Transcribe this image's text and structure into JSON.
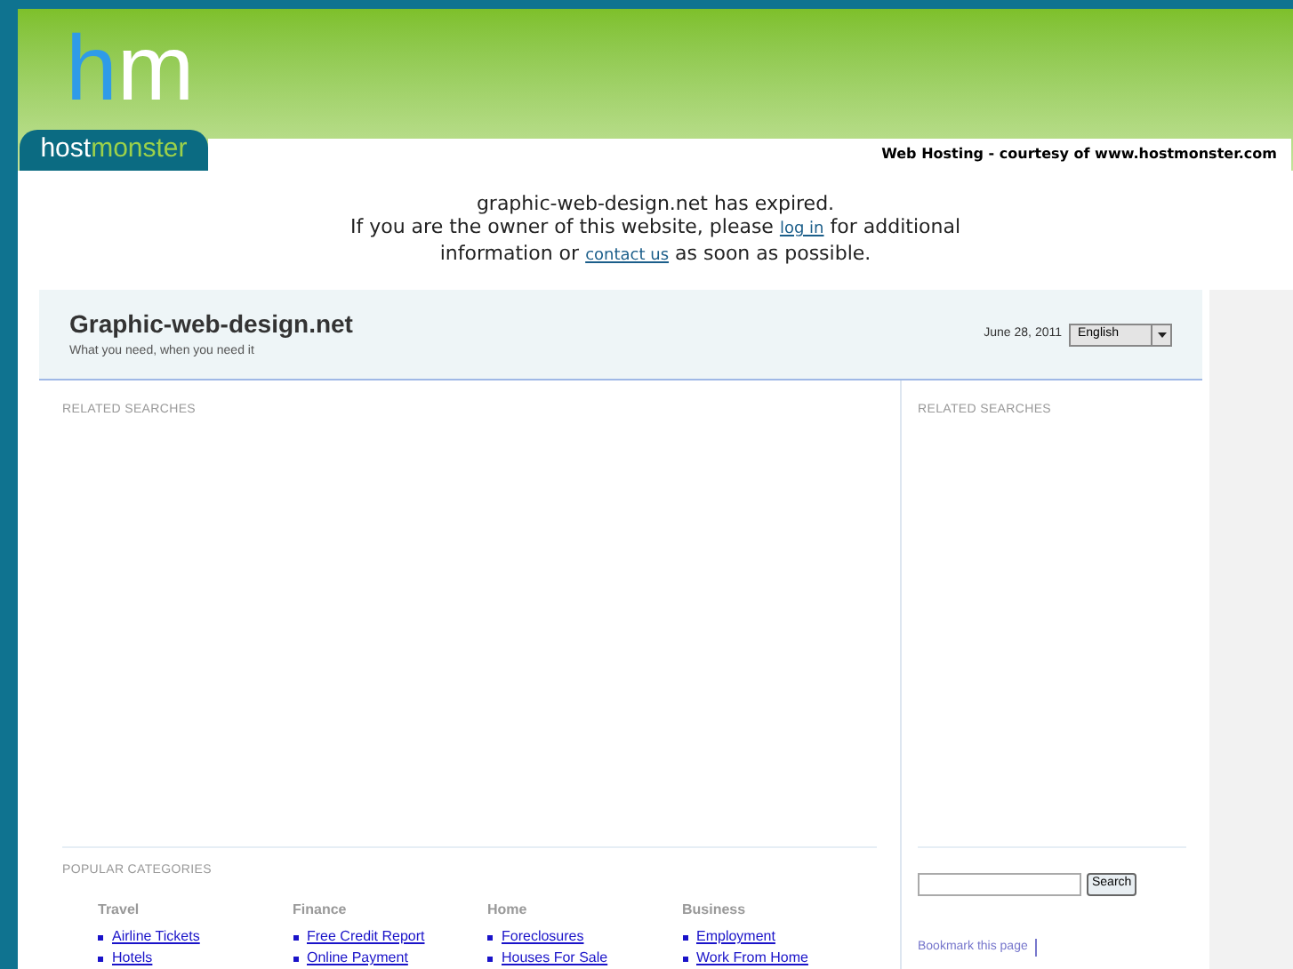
{
  "host_banner": {
    "logo_mark": "hm",
    "logo_word_1": "host",
    "logo_word_2": "monster",
    "courtesy": "Web Hosting - courtesy of www.hostmonster.com"
  },
  "notice": {
    "line_1": "graphic-web-design.net has expired.",
    "line_2_before": "If you are the owner of this website, please",
    "login_link": "log in",
    "line_2_after": "for additional",
    "line_3_before": "information or",
    "contact_link": "contact us",
    "line_3_after": "as soon as possible."
  },
  "site_header": {
    "title": "Graphic-web-design.net",
    "tagline": "What you need, when you need it",
    "date": "June 28, 2011",
    "language": "English"
  },
  "main": {
    "related_heading": "RELATED SEARCHES",
    "popular_heading": "POPULAR CATEGORIES",
    "categories": [
      {
        "name": "Travel",
        "links": [
          "Airline Tickets",
          "Hotels"
        ]
      },
      {
        "name": "Finance",
        "links": [
          "Free Credit Report",
          "Online Payment"
        ]
      },
      {
        "name": "Home",
        "links": [
          "Foreclosures",
          "Houses For Sale"
        ]
      },
      {
        "name": "Business",
        "links": [
          "Employment",
          "Work From Home"
        ]
      }
    ]
  },
  "sidebar": {
    "related_heading": "RELATED SEARCHES",
    "search_button": "Search",
    "bookmark_link": "Bookmark this page"
  }
}
